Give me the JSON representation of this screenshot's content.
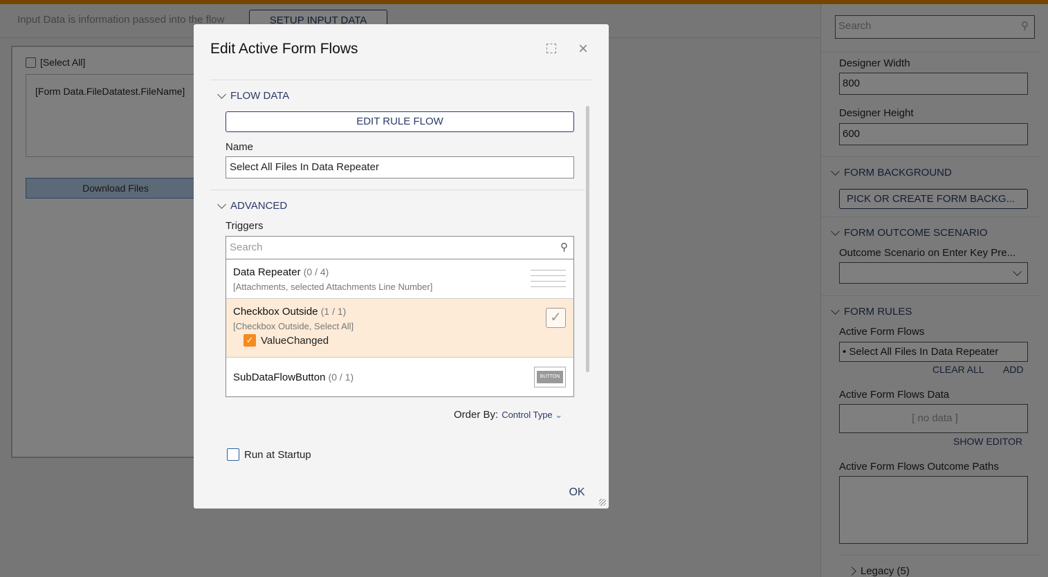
{
  "background": {
    "hint": "Input Data is information passed into the flow",
    "setup_button": "SETUP INPUT DATA",
    "select_all": "[Select All]",
    "file_name": "[Form Data.FileDatatest.FileName]",
    "download_button": "Download Files"
  },
  "panel": {
    "search_placeholder": "Search",
    "designer_width_label": "Designer Width",
    "designer_width": "800",
    "designer_height_label": "Designer Height",
    "designer_height": "600",
    "form_background": "FORM BACKGROUND",
    "pick_background": "PICK OR CREATE FORM BACKG...",
    "form_outcome": "FORM OUTCOME SCENARIO",
    "outcome_label": "Outcome Scenario on Enter Key Pre...",
    "form_rules": "FORM RULES",
    "active_flows_label": "Active Form Flows",
    "active_flow_item": "Select All Files In Data Repeater",
    "clear_all": "CLEAR ALL",
    "add": "ADD",
    "flows_data_label": "Active Form Flows Data",
    "no_data": "[ no data ]",
    "show_editor": "SHOW EDITOR",
    "outcome_paths_label": "Active Form Flows Outcome Paths",
    "legacy": "Legacy (5)"
  },
  "modal": {
    "title": "Edit Active Form Flows",
    "flow_data": "FLOW DATA",
    "edit_rule_flow": "EDIT RULE FLOW",
    "name_label": "Name",
    "name_value": "Select All Files In Data Repeater",
    "advanced": "ADVANCED",
    "triggers_label": "Triggers",
    "search_placeholder": "Search",
    "triggers": [
      {
        "name": "Data Repeater",
        "count": "(0 / 4)",
        "sub": "[Attachments, selected Attachments Line Number]",
        "icon": "data-repeater-icon"
      },
      {
        "name": "Checkbox Outside",
        "count": "(1 / 1)",
        "sub": "[Checkbox Outside, Select All]",
        "event": "ValueChanged",
        "event_checked": true,
        "icon": "checkbox-icon",
        "highlight": "#fdebd8"
      },
      {
        "name": "SubDataFlowButton",
        "count": "(0 / 1)",
        "icon": "button-icon",
        "icon_text": "BUTTON"
      }
    ],
    "order_by_label": "Order By:",
    "order_by_value": "Control Type",
    "run_at_startup": "Run at Startup",
    "run_at_startup_checked": false,
    "ok": "OK"
  },
  "colors": {
    "accent": "#f08a00",
    "primary": "#2b3a67",
    "highlight": "#fdebd8"
  }
}
